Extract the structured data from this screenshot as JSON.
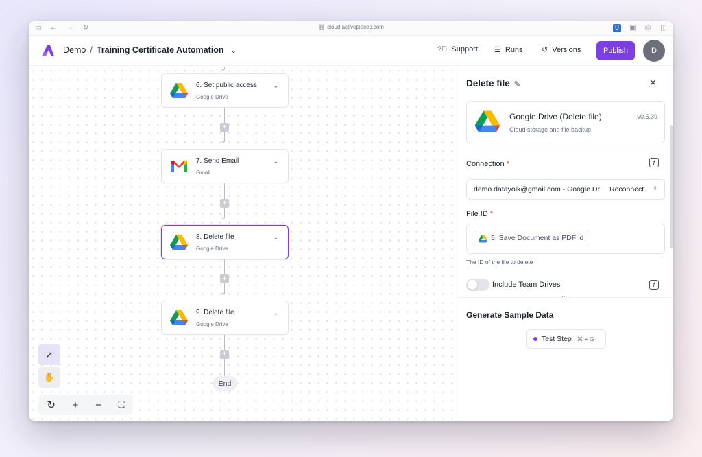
{
  "browser": {
    "url": "cloud.activepieces.com"
  },
  "header": {
    "project": "Demo",
    "separator": "/",
    "flow_name": "Training Certificate Automation",
    "support_label": "Support",
    "runs_label": "Runs",
    "versions_label": "Versions",
    "publish_label": "Publish",
    "avatar_initial": "D"
  },
  "canvas": {
    "nodes": [
      {
        "title": "6. Set public access",
        "subtitle": "Google Drive",
        "icon": "google-drive-icon"
      },
      {
        "title": "7. Send Email",
        "subtitle": "Gmail",
        "icon": "gmail-icon"
      },
      {
        "title": "8. Delete file",
        "subtitle": "Google Drive",
        "icon": "google-drive-icon",
        "selected": true
      },
      {
        "title": "9. Delete file",
        "subtitle": "Google Drive",
        "icon": "google-drive-icon"
      }
    ],
    "end_label": "End",
    "tools": [
      "select-pointer-icon",
      "pan-hand-icon"
    ],
    "zoom_controls": [
      "reset-icon",
      "zoom-in-icon",
      "zoom-out-icon",
      "fit-view-icon"
    ]
  },
  "panel": {
    "title": "Delete file",
    "piece": {
      "name": "Google Drive (Delete file)",
      "description": "Cloud storage and file backup",
      "version": "v0.5.39"
    },
    "connection": {
      "label": "Connection",
      "required_mark": "*",
      "value": "demo.datayolk@gmail.com - Google Dr",
      "reconnect_label": "Reconnect"
    },
    "file_id": {
      "label": "File ID",
      "required_mark": "*",
      "chip_text": "5. Save Document as PDF id",
      "hint": "The ID of the file to delete"
    },
    "team_drives": {
      "label": "Include Team Drives",
      "enabled": false
    },
    "sample": {
      "title": "Generate Sample Data",
      "test_label": "Test Step",
      "shortcut": "⌘ + G"
    }
  },
  "colors": {
    "accent": "#7b3fe4",
    "required": "#e0394a"
  }
}
